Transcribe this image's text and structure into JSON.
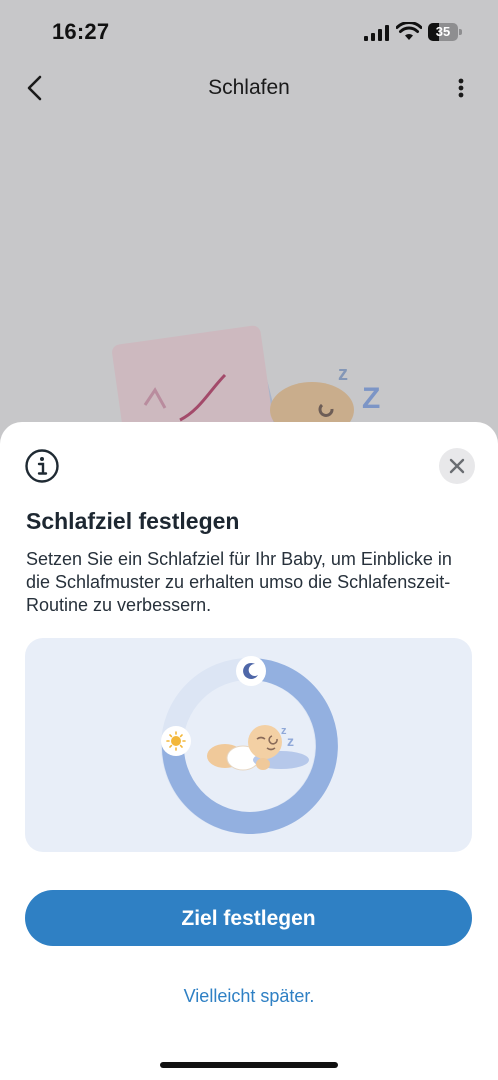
{
  "status_bar": {
    "time": "16:27",
    "battery_level": "35",
    "battery_percent": 35
  },
  "nav": {
    "title": "Schlafen",
    "back_icon": "chevron-left-icon",
    "more_icon": "more-vertical-icon"
  },
  "sheet": {
    "info_icon": "info-icon",
    "close_icon": "close-icon",
    "title": "Schlafziel festlegen",
    "description": "Setzen Sie ein Schlafziel für Ihr Baby, um Einblicke in die Schlafmuster zu erhalten umso die Schlafenszeit-Routine zu verbessern.",
    "primary_button": "Ziel festlegen",
    "secondary_link": "Vielleicht später."
  },
  "illustration": {
    "sleep_letters_small": "z",
    "sleep_letters_large": "Z",
    "sun_icon": "sun-icon",
    "moon_icon": "moon-icon"
  },
  "colors": {
    "accent": "#2f80c4",
    "overlay": "#c7c7c9",
    "card_bg": "#e8eef8",
    "ring": "#93b0e0"
  }
}
